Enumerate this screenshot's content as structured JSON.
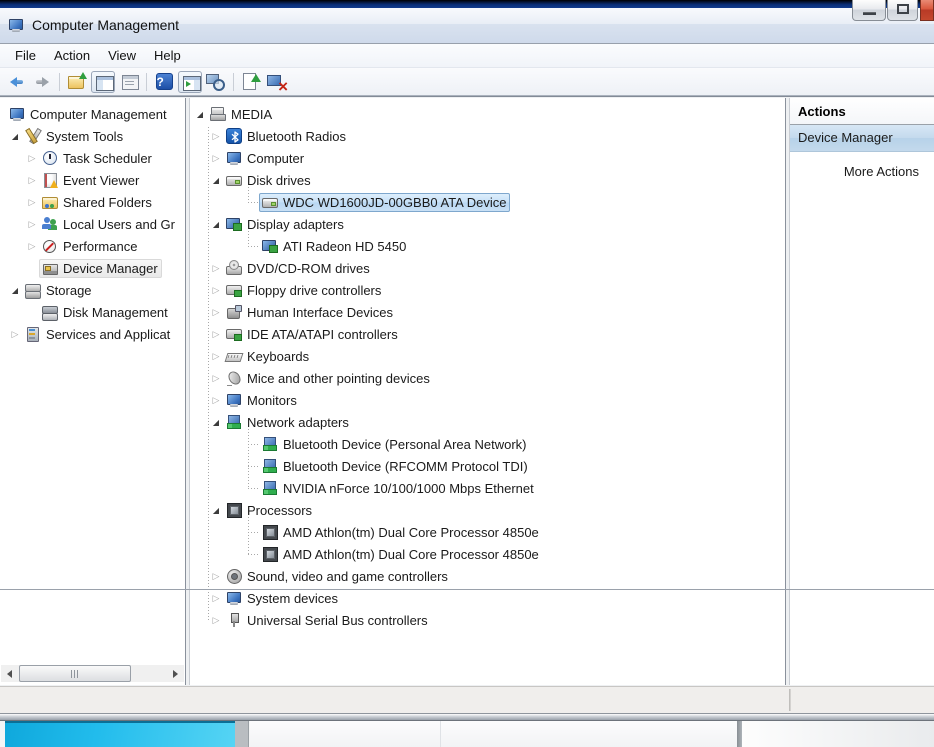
{
  "window": {
    "title": "Computer Management",
    "controls": [
      {
        "name": "minimize-button"
      },
      {
        "name": "maximize-button"
      },
      {
        "name": "close-button"
      }
    ]
  },
  "menu_bar": {
    "items": [
      {
        "label": "File"
      },
      {
        "label": "Action"
      },
      {
        "label": "View"
      },
      {
        "label": "Help"
      }
    ]
  },
  "toolbar": {
    "buttons": [
      {
        "name": "back-icon",
        "pressed": false
      },
      {
        "name": "forward-icon",
        "pressed": false
      },
      {
        "name": "up-one-level-folder-icon",
        "pressed": false
      },
      {
        "name": "show-console-tree-icon",
        "pressed": true
      },
      {
        "name": "export-list-icon",
        "pressed": false
      },
      {
        "name": "help-icon",
        "pressed": false
      },
      {
        "name": "show-action-pane-icon",
        "pressed": true
      },
      {
        "name": "scan-for-hardware-changes-icon",
        "pressed": false
      },
      {
        "name": "update-driver-icon",
        "pressed": false
      },
      {
        "name": "uninstall-device-icon",
        "pressed": false
      }
    ]
  },
  "console_tree": {
    "items": [
      {
        "label": "Computer Management",
        "icon": "computer-icon",
        "level": 0,
        "expand": "none",
        "selected": false
      },
      {
        "label": "System Tools",
        "icon": "system-tools-icon",
        "level": 1,
        "expand": "expanded",
        "selected": false
      },
      {
        "label": "Task Scheduler",
        "icon": "task-scheduler-icon",
        "level": 2,
        "expand": "collapsed",
        "selected": false
      },
      {
        "label": "Event Viewer",
        "icon": "event-viewer-icon",
        "level": 2,
        "expand": "collapsed",
        "selected": false
      },
      {
        "label": "Shared Folders",
        "icon": "shared-folders-icon",
        "level": 2,
        "expand": "collapsed",
        "selected": false
      },
      {
        "label": "Local Users and Gr",
        "icon": "local-users-groups-icon",
        "level": 2,
        "expand": "collapsed",
        "selected": false
      },
      {
        "label": "Performance",
        "icon": "performance-icon",
        "level": 2,
        "expand": "collapsed",
        "selected": false
      },
      {
        "label": "Device Manager",
        "icon": "device-manager-icon",
        "level": 2,
        "expand": "none",
        "selected": true
      },
      {
        "label": "Storage",
        "icon": "storage-icon",
        "level": 1,
        "expand": "expanded",
        "selected": false
      },
      {
        "label": "Disk Management",
        "icon": "disk-management-icon",
        "level": 2,
        "expand": "none",
        "selected": false
      },
      {
        "label": "Services and Applicat",
        "icon": "services-applications-icon",
        "level": 1,
        "expand": "collapsed",
        "selected": false
      }
    ]
  },
  "device_tree": {
    "items": [
      {
        "label": "MEDIA",
        "icon": "computer-root-icon",
        "level": 0,
        "expand": "expanded",
        "selected": false
      },
      {
        "label": "Bluetooth Radios",
        "icon": "bluetooth-radio-icon",
        "level": 1,
        "expand": "collapsed",
        "selected": false
      },
      {
        "label": "Computer",
        "icon": "computer-icon",
        "level": 1,
        "expand": "collapsed",
        "selected": false
      },
      {
        "label": "Disk drives",
        "icon": "disk-drive-icon",
        "level": 1,
        "expand": "expanded",
        "selected": false
      },
      {
        "label": "WDC WD1600JD-00GBB0 ATA Device",
        "icon": "disk-drive-icon",
        "level": 2,
        "expand": "none",
        "selected": true
      },
      {
        "label": "Display adapters",
        "icon": "display-adapter-icon",
        "level": 1,
        "expand": "expanded",
        "selected": false
      },
      {
        "label": "ATI Radeon HD 5450",
        "icon": "display-adapter-icon",
        "level": 2,
        "expand": "none",
        "selected": false
      },
      {
        "label": "DVD/CD-ROM drives",
        "icon": "dvd-drive-icon",
        "level": 1,
        "expand": "collapsed",
        "selected": false
      },
      {
        "label": "Floppy drive controllers",
        "icon": "floppy-controller-icon",
        "level": 1,
        "expand": "collapsed",
        "selected": false
      },
      {
        "label": "Human Interface Devices",
        "icon": "hid-icon",
        "level": 1,
        "expand": "collapsed",
        "selected": false
      },
      {
        "label": "IDE ATA/ATAPI controllers",
        "icon": "ide-controller-icon",
        "level": 1,
        "expand": "collapsed",
        "selected": false
      },
      {
        "label": "Keyboards",
        "icon": "keyboard-icon",
        "level": 1,
        "expand": "collapsed",
        "selected": false
      },
      {
        "label": "Mice and other pointing devices",
        "icon": "mouse-icon",
        "level": 1,
        "expand": "collapsed",
        "selected": false
      },
      {
        "label": "Monitors",
        "icon": "monitor-icon",
        "level": 1,
        "expand": "collapsed",
        "selected": false
      },
      {
        "label": "Network adapters",
        "icon": "network-adapter-icon",
        "level": 1,
        "expand": "expanded",
        "selected": false
      },
      {
        "label": "Bluetooth Device (Personal Area Network)",
        "icon": "network-adapter-icon",
        "level": 2,
        "expand": "none",
        "selected": false
      },
      {
        "label": "Bluetooth Device (RFCOMM Protocol TDI)",
        "icon": "network-adapter-icon",
        "level": 2,
        "expand": "none",
        "selected": false
      },
      {
        "label": "NVIDIA nForce 10/100/1000 Mbps Ethernet",
        "icon": "network-adapter-icon",
        "level": 2,
        "expand": "none",
        "selected": false
      },
      {
        "label": "Processors",
        "icon": "processor-icon",
        "level": 1,
        "expand": "expanded",
        "selected": false
      },
      {
        "label": "AMD Athlon(tm) Dual Core Processor 4850e",
        "icon": "processor-icon",
        "level": 2,
        "expand": "none",
        "selected": false
      },
      {
        "label": "AMD Athlon(tm) Dual Core Processor 4850e",
        "icon": "processor-icon",
        "level": 2,
        "expand": "none",
        "selected": false
      },
      {
        "label": "Sound, video and game controllers",
        "icon": "sound-icon",
        "level": 1,
        "expand": "collapsed",
        "selected": false
      },
      {
        "label": "System devices",
        "icon": "system-devices-icon",
        "level": 1,
        "expand": "collapsed",
        "selected": false
      },
      {
        "label": "Universal Serial Bus controllers",
        "icon": "usb-icon",
        "level": 1,
        "expand": "collapsed",
        "selected": false
      }
    ]
  },
  "actions_panel": {
    "header": "Actions",
    "section_title": "Device Manager",
    "more_actions_label": "More Actions"
  },
  "colors": {
    "selection_active_bg": "#c6e0f7",
    "selection_active_border": "#7ea7cd",
    "selection_inactive_bg": "#ececec",
    "actions_highlight": "#c4daed",
    "titlebar_gradient_top": "#f8fafd",
    "titlebar_gradient_bottom": "#cfdaeb",
    "close_button_red": "#c4482e",
    "desktop_cyan": "#22bcec",
    "top_strip_navy": "#0a2d74"
  }
}
